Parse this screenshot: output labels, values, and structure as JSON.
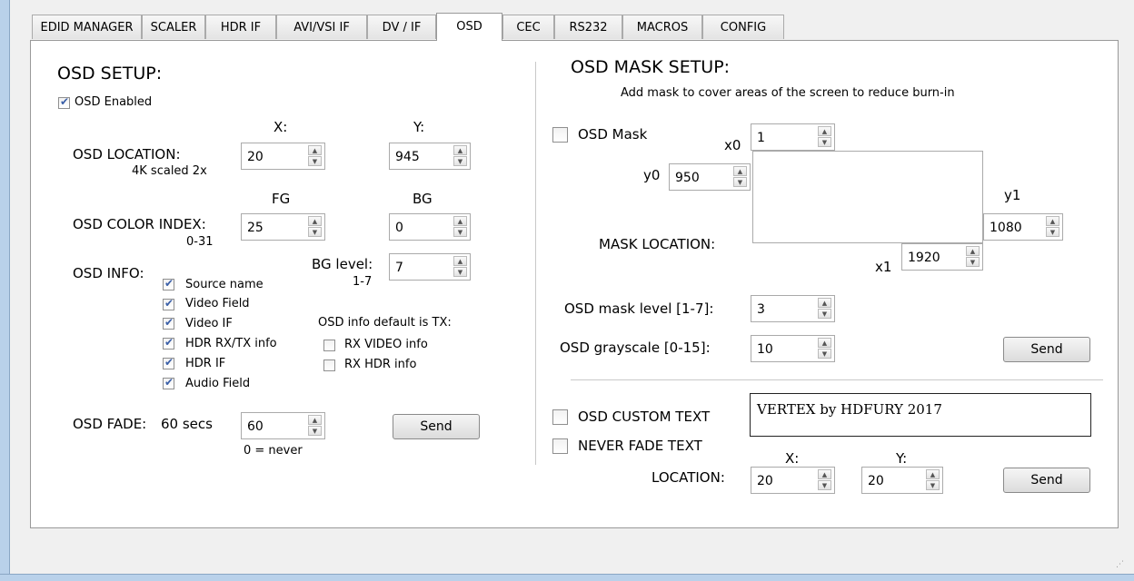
{
  "tabs": [
    "EDID MANAGER",
    "SCALER",
    "HDR IF",
    "AVI/VSI IF",
    "DV / IF",
    "OSD",
    "CEC",
    "RS232",
    "MACROS",
    "CONFIG"
  ],
  "active_tab": "OSD",
  "left": {
    "title": "OSD SETUP:",
    "osd_enabled_label": "OSD Enabled",
    "x_header": "X:",
    "y_header": "Y:",
    "location_label": "OSD LOCATION:",
    "location_note": "4K scaled 2x",
    "location_x": "20",
    "location_y": "945",
    "fg_header": "FG",
    "bg_header": "BG",
    "color_label": "OSD COLOR INDEX:",
    "color_note": "0-31",
    "fg_value": "25",
    "bg_value": "0",
    "info_label": "OSD INFO:",
    "bg_level_label": "BG level:",
    "bg_level_note": "1-7",
    "bg_level_value": "7",
    "info_items": [
      "Source name",
      "Video Field",
      "Video IF",
      "HDR RX/TX info",
      "HDR IF",
      "Audio Field"
    ],
    "info_default_label": "OSD info default is TX:",
    "rx_video_label": "RX VIDEO info",
    "rx_hdr_label": "RX HDR info",
    "fade_label": "OSD FADE:",
    "fade_secs": "60 secs",
    "fade_value": "60",
    "fade_note": "0 = never",
    "send": "Send"
  },
  "right": {
    "title": "OSD MASK SETUP:",
    "subtitle": "Add mask to cover areas of the screen to reduce burn-in",
    "mask_label": "OSD Mask",
    "x0_label": "x0",
    "x0_value": "1",
    "y0_label": "y0",
    "y0_value": "950",
    "y1_label": "y1",
    "y1_value": "1080",
    "x1_label": "x1",
    "x1_value": "1920",
    "mask_location_label": "MASK LOCATION:",
    "mask_level_label": "OSD mask level [1-7]:",
    "mask_level_value": "3",
    "grayscale_label": "OSD grayscale [0-15]:",
    "grayscale_value": "10",
    "send": "Send",
    "custom_text_label": "OSD CUSTOM TEXT",
    "custom_text_value": "VERTEX by HDFURY 2017",
    "never_fade_label": "NEVER FADE TEXT",
    "x_header": "X:",
    "y_header": "Y:",
    "location_label": "LOCATION:",
    "text_x": "20",
    "text_y": "20",
    "send2": "Send"
  }
}
